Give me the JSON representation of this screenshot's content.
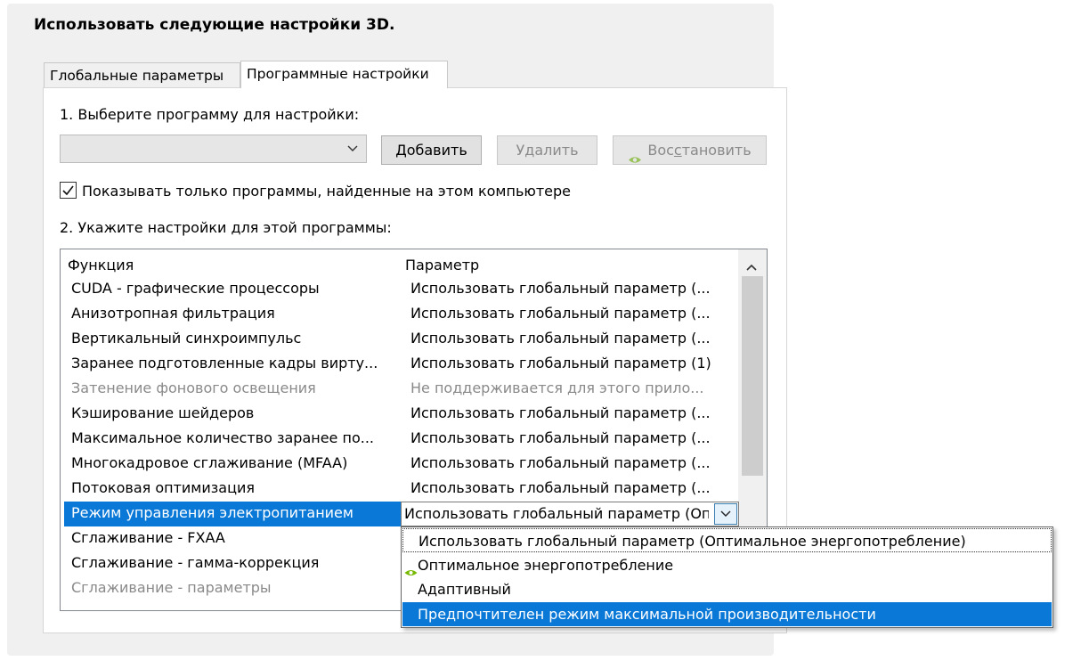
{
  "heading": "Использовать следующие настройки 3D.",
  "tabs": [
    {
      "label": "Глобальные параметры",
      "active": false
    },
    {
      "label": "Программные настройки",
      "active": true
    }
  ],
  "step1": {
    "label": "1. Выберите программу для настройки:",
    "program_value": "",
    "add_label": "Добавить",
    "remove_label": "Удалить",
    "restore_label_pre": "Вос",
    "restore_label_u": "с",
    "restore_label_post": "тановить"
  },
  "show_only": {
    "checked": true,
    "label": "Показывать только программы, найденные на этом компьютере"
  },
  "step2": {
    "label": "2. Укажите настройки для этой программы:",
    "columns": [
      "Функция",
      "Параметр"
    ],
    "rows": [
      {
        "feature": "CUDA - графические процессоры",
        "value": "Использовать глобальный параметр (..."
      },
      {
        "feature": "Анизотропная фильтрация",
        "value": "Использовать глобальный параметр (..."
      },
      {
        "feature": "Вертикальный синхроимпульс",
        "value": "Использовать глобальный параметр (..."
      },
      {
        "feature": "Заранее подготовленные кадры вирту...",
        "value": "Использовать глобальный параметр (1)"
      },
      {
        "feature": "Затенение фонового освещения",
        "value": "Не поддерживается для этого прило..."
      },
      {
        "feature": "Кэширование шейдеров",
        "value": "Использовать глобальный параметр (..."
      },
      {
        "feature": "Максимальное количество заранее по...",
        "value": "Использовать глобальный параметр (..."
      },
      {
        "feature": "Многокадровое сглаживание (MFAA)",
        "value": "Использовать глобальный параметр (..."
      },
      {
        "feature": "Потоковая оптимизация",
        "value": "Использовать глобальный параметр (..."
      },
      {
        "feature": "Режим управления электропитанием",
        "value": "Использовать глобальный параметр (Оптимальное энергопотребление)"
      },
      {
        "feature": "Сглаживание - FXAA",
        "value": ""
      },
      {
        "feature": "Сглаживание - гамма-коррекция",
        "value": ""
      },
      {
        "feature": "Сглаживание - параметры",
        "value": ""
      }
    ],
    "dropdown_options": [
      "Использовать глобальный параметр (Оптимальное энергопотребление)",
      "Оптимальное энергопотребление",
      "Адаптивный",
      "Предпочтителен режим максимальной производительности"
    ]
  },
  "colors": {
    "selection": "#0a78d7",
    "nvidia_green": "#76b900"
  }
}
